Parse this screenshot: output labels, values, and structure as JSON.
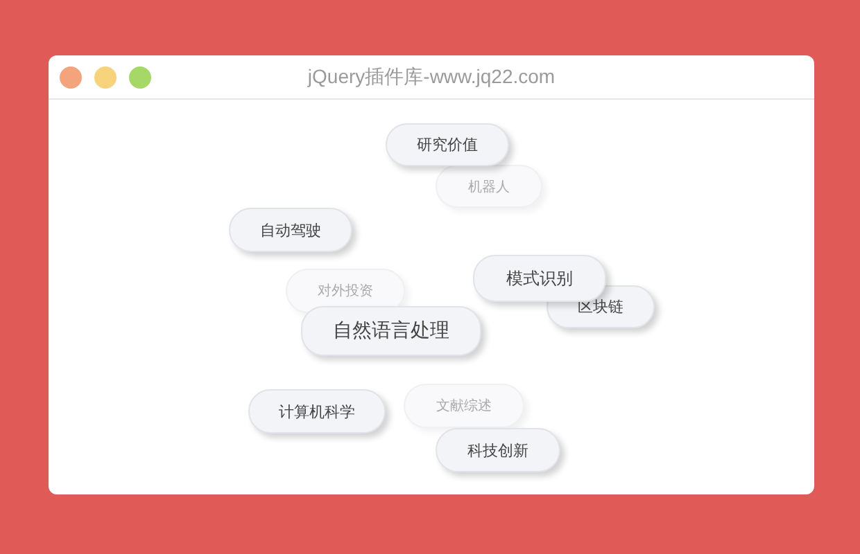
{
  "window": {
    "title": "jQuery插件库-www.jq22.com"
  },
  "tags": [
    {
      "label": "研究价值",
      "faded": false
    },
    {
      "label": "机器人",
      "faded": true
    },
    {
      "label": "自动驾驶",
      "faded": false
    },
    {
      "label": "对外投资",
      "faded": true
    },
    {
      "label": "区块链",
      "faded": false
    },
    {
      "label": "模式识别",
      "faded": false
    },
    {
      "label": "自然语言处理",
      "faded": false
    },
    {
      "label": "计算机科学",
      "faded": false
    },
    {
      "label": "文献综述",
      "faded": true
    },
    {
      "label": "科技创新",
      "faded": false
    }
  ]
}
